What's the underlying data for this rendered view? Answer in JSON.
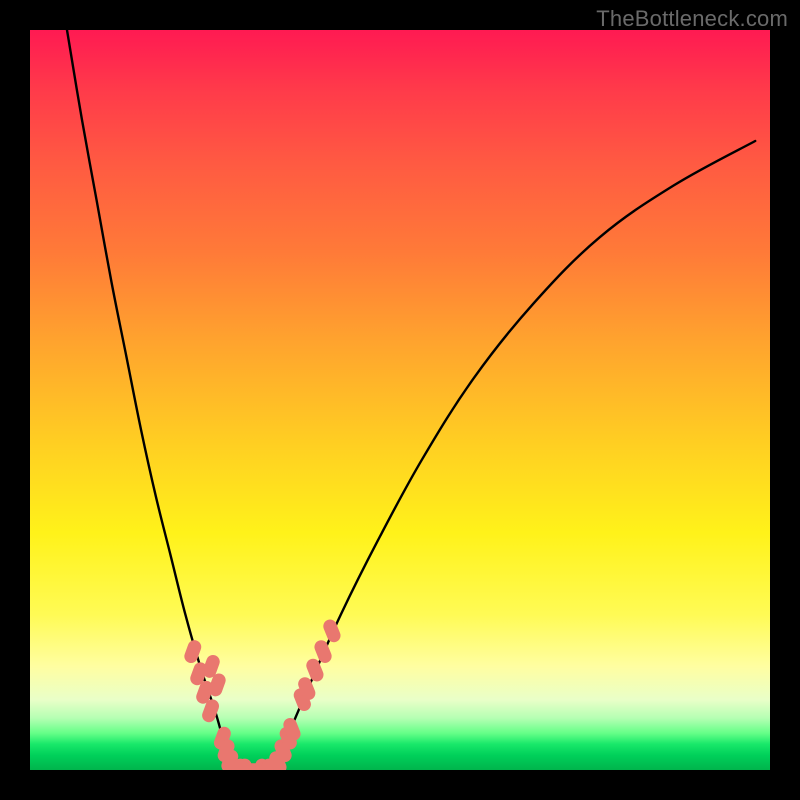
{
  "watermark": {
    "text": "TheBottleneck.com"
  },
  "chart_data": {
    "type": "line",
    "title": "",
    "xlabel": "",
    "ylabel": "",
    "xlim": [
      0,
      100
    ],
    "ylim": [
      0,
      100
    ],
    "series": [
      {
        "name": "left-curve",
        "x": [
          5,
          7,
          9,
          11,
          13,
          15,
          17,
          19,
          21,
          23,
          25,
          26.5,
          28
        ],
        "y": [
          100,
          88,
          77,
          66,
          56,
          46,
          37,
          29,
          21,
          14,
          8,
          3,
          0
        ]
      },
      {
        "name": "right-curve",
        "x": [
          33,
          35,
          38,
          42,
          47,
          53,
          60,
          68,
          77,
          87,
          98
        ],
        "y": [
          0,
          5,
          12,
          21,
          31,
          42,
          53,
          63,
          72,
          79,
          85
        ]
      },
      {
        "name": "valley-floor",
        "x": [
          28,
          30.5,
          33
        ],
        "y": [
          0,
          0,
          0
        ]
      },
      {
        "name": "left-markers",
        "x": [
          22.0,
          22.8,
          23.6,
          24.4,
          24.5,
          25.3,
          26.0,
          26.5,
          27.0,
          28.2,
          28.8
        ],
        "y": [
          16.0,
          13.0,
          10.5,
          8.0,
          14.0,
          11.5,
          4.3,
          2.6,
          1.2,
          0.0,
          0.0
        ]
      },
      {
        "name": "right-markers",
        "x": [
          31.6,
          32.5,
          33.5,
          34.2,
          34.9,
          35.4,
          36.8,
          37.4,
          38.5,
          39.6,
          40.8
        ],
        "y": [
          0.0,
          0.0,
          1.0,
          2.6,
          4.3,
          5.5,
          9.5,
          11.0,
          13.5,
          16.0,
          18.8
        ]
      }
    ],
    "marker_style": {
      "color": "#e9776f",
      "radius_px": 9
    },
    "background_gradient": {
      "top": "#ff1a52",
      "mid": "#fff21a",
      "bottom": "#00b44c"
    }
  }
}
